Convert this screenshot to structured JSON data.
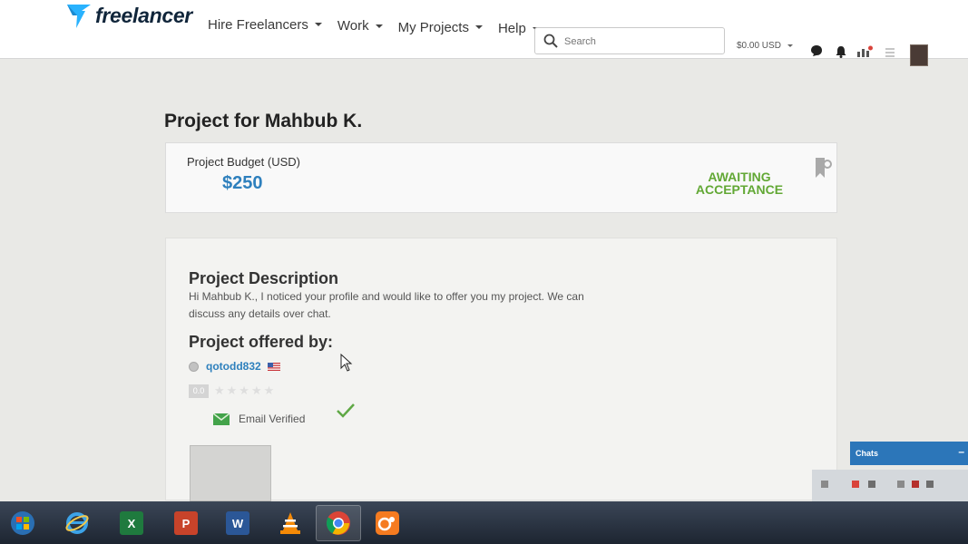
{
  "header": {
    "logo_text": "freelancer",
    "nav": [
      {
        "label": "Hire Freelancers"
      },
      {
        "label": "Work"
      },
      {
        "label": "My Projects"
      },
      {
        "label": "Help"
      }
    ],
    "search_placeholder": "Search",
    "balance": "$0.00 USD"
  },
  "main": {
    "page_title": "Project for Mahbub K.",
    "budget": {
      "label": "Project Budget (USD)",
      "value": "$250",
      "status_line1": "AWAITING",
      "status_line2": "ACCEPTANCE"
    },
    "description": {
      "title": "Project Description",
      "text": "Hi Mahbub K., I noticed your profile and would like to offer you my project. We can discuss any details over chat."
    },
    "offered_by": {
      "title": "Project offered by:",
      "username": "qotodd832",
      "rating": "0.0",
      "stars": "★★★★★",
      "email_verified_label": "Email Verified"
    }
  },
  "chats": {
    "label": "Chats",
    "minimize": "–"
  },
  "taskbar": {
    "apps": [
      {
        "icon": "windows-start-icon"
      },
      {
        "icon": "internet-explorer-icon"
      },
      {
        "icon": "excel-icon",
        "glyph": "X"
      },
      {
        "icon": "powerpoint-icon",
        "glyph": "P"
      },
      {
        "icon": "word-icon",
        "glyph": "W"
      },
      {
        "icon": "vlc-icon"
      },
      {
        "icon": "chrome-icon"
      },
      {
        "icon": "uc-browser-icon"
      }
    ],
    "colors": {
      "excel": "#1f7a3e",
      "powerpoint": "#c8432a",
      "word": "#2b5797",
      "accent": "#2e80bd",
      "status": "#62a835"
    }
  }
}
